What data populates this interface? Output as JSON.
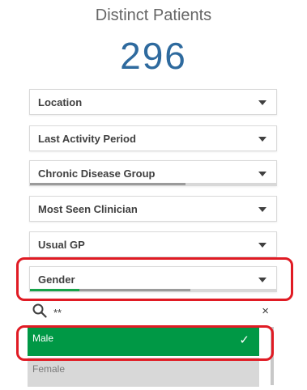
{
  "kpi": {
    "title": "Distinct Patients",
    "value": "296"
  },
  "filters": [
    {
      "label": "Location",
      "bar": "none"
    },
    {
      "label": "Last Activity Period",
      "bar": "none"
    },
    {
      "label": "Chronic Disease Group",
      "bar": "gray",
      "bar_fill_fraction": 0.63
    },
    {
      "label": "Most Seen Clinician",
      "bar": "none"
    },
    {
      "label": "Usual GP",
      "bar": "none"
    },
    {
      "label": "Gender",
      "bar": "green-gray",
      "selected_fraction": 0.2,
      "possible_fraction": 0.65
    }
  ],
  "dropdown": {
    "search_value": "**",
    "search_icon": "search-icon",
    "clear_icon": "close-icon",
    "clear_glyph": "×",
    "options": [
      {
        "label": "Male",
        "state": "selected",
        "check_glyph": "✓"
      },
      {
        "label": "Female",
        "state": "excluded"
      }
    ]
  },
  "colors": {
    "kpi_value": "#2e6a9e",
    "selected_green": "#009845",
    "excluded_gray": "#d8d8d8",
    "annotation_red": "#e01b24"
  }
}
